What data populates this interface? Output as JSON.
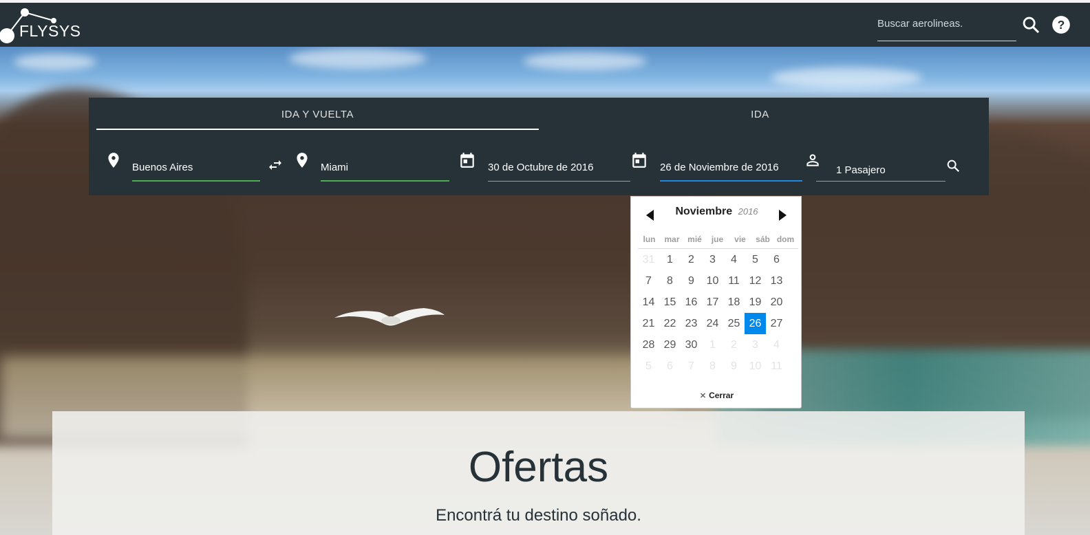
{
  "navbar": {
    "logo_text": "FLYSYS",
    "search_placeholder": "Buscar aerolineas.",
    "search_icon": "search-icon",
    "help_icon": "help-icon"
  },
  "search_panel": {
    "tabs": [
      {
        "label": "IDA Y VUELTA",
        "active": true
      },
      {
        "label": "IDA",
        "active": false
      }
    ],
    "origin": "Buenos Aires",
    "destination": "Miami",
    "departure_date": "30 de Octubre de 2016",
    "return_date": "26 de Noviembre de 2016",
    "passengers": "1 Pasajero",
    "icons": [
      "location-icon",
      "swap-icon",
      "calendar-icon",
      "person-icon",
      "search-icon"
    ]
  },
  "datepicker": {
    "month": "Noviembre",
    "year": "2016",
    "weekdays": [
      "lun",
      "mar",
      "mié",
      "jue",
      "vie",
      "sáb",
      "dom"
    ],
    "days": [
      [
        "31",
        "1",
        "2",
        "3",
        "4",
        "5",
        "6"
      ],
      [
        "7",
        "8",
        "9",
        "10",
        "11",
        "12",
        "13"
      ],
      [
        "14",
        "15",
        "16",
        "17",
        "18",
        "19",
        "20"
      ],
      [
        "21",
        "22",
        "23",
        "24",
        "25",
        "26",
        "27"
      ],
      [
        "28",
        "29",
        "30",
        "1",
        "2",
        "3",
        "4"
      ],
      [
        "5",
        "6",
        "7",
        "8",
        "9",
        "10",
        "11"
      ]
    ],
    "selected_day": "26",
    "close_label": "Cerrar",
    "close_icon": "close-icon"
  },
  "ofertas": {
    "title": "Ofertas",
    "subtitle": "Encontrá tu destino soñado."
  },
  "colors": {
    "navbar": "#263238",
    "accent_green": "#4caf50",
    "accent_blue": "#1e88e5",
    "selected_day": "#0089ec"
  }
}
